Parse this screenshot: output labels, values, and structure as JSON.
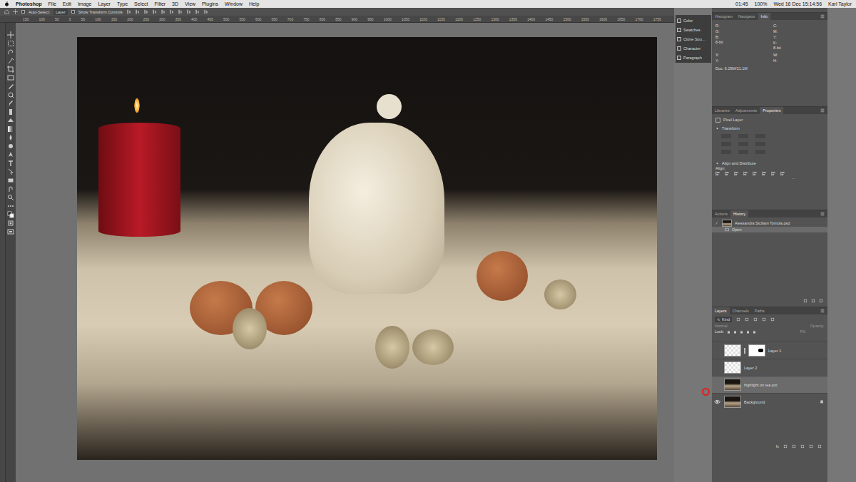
{
  "menubar": {
    "app": "Photoshop",
    "menus": [
      "File",
      "Edit",
      "Image",
      "Layer",
      "Type",
      "Select",
      "Filter",
      "3D",
      "View",
      "Plugins",
      "Window",
      "Help"
    ],
    "status": [
      "01:45",
      "100%",
      "Wed 16 Dec 15:14:56",
      "Karl Taylor"
    ]
  },
  "options_bar": {
    "auto_select_label": "Auto-Select:",
    "auto_select_checked": false,
    "auto_select_value": "Layer",
    "transform_label": "Show Transform Controls",
    "transform_checked": false
  },
  "ruler": [
    "150",
    "100",
    "50",
    "0",
    "50",
    "100",
    "150",
    "200",
    "250",
    "300",
    "350",
    "400",
    "450",
    "500",
    "550",
    "600",
    "650",
    "700",
    "750",
    "800",
    "850",
    "900",
    "950",
    "1000",
    "1050",
    "1100",
    "1150",
    "1200",
    "1250",
    "1300",
    "1350",
    "1400",
    "1450",
    "1500",
    "1550",
    "1600",
    "1650",
    "1700",
    "1750"
  ],
  "mini_panel": [
    "Color",
    "Swatches",
    "Clone Sou…",
    "Character",
    "Paragraph"
  ],
  "info_panel": {
    "tabs": [
      {
        "label": "Histogram",
        "selected": false
      },
      {
        "label": "Navigator",
        "selected": false
      },
      {
        "label": "Info",
        "selected": true
      }
    ],
    "rgb": [
      "R:",
      "G:",
      "B:"
    ],
    "rgb_bits": "8-bit",
    "cmyk": [
      "C:",
      "M:",
      "Y:",
      "K:"
    ],
    "cmyk_bits": "8-bit",
    "xy": [
      "X:",
      "Y:"
    ],
    "wh": [
      "W:",
      "H:"
    ],
    "doc": "Doc: 6.29M/21.1M"
  },
  "properties_panel": {
    "tabs": [
      {
        "label": "Libraries",
        "selected": false
      },
      {
        "label": "Adjustments",
        "selected": false
      },
      {
        "label": "Properties",
        "selected": true
      }
    ],
    "layer_type": "Pixel Layer",
    "transform": "Transform",
    "align": "Align and Distribute",
    "align_label": "Align:",
    "more": "···"
  },
  "history_panel": {
    "tabs": [
      {
        "label": "Actions",
        "selected": false
      },
      {
        "label": "History",
        "selected": true
      }
    ],
    "snapshot": "Alessandra Siciliani Tomola.psd",
    "steps": [
      {
        "label": "Open",
        "selected": true
      }
    ]
  },
  "layers_panel": {
    "tabs": [
      {
        "label": "Layers",
        "selected": true
      },
      {
        "label": "Channels",
        "selected": false
      },
      {
        "label": "Paths",
        "selected": false
      }
    ],
    "filter": "Kind",
    "blend": "Normal",
    "opacity_label": "Opacity:",
    "lock_label": "Lock:",
    "fill_label": "Fill:",
    "layers": [
      {
        "name": "Layer 1",
        "visible": false,
        "selected": false,
        "kind": "masked"
      },
      {
        "name": "Layer 2",
        "visible": false,
        "selected": false,
        "kind": "transparent"
      },
      {
        "name": "highlight on tea pot",
        "visible": false,
        "selected": true,
        "kind": "photo"
      },
      {
        "name": "Background",
        "visible": true,
        "selected": false,
        "kind": "locked"
      }
    ],
    "footer": [
      "fx"
    ]
  }
}
